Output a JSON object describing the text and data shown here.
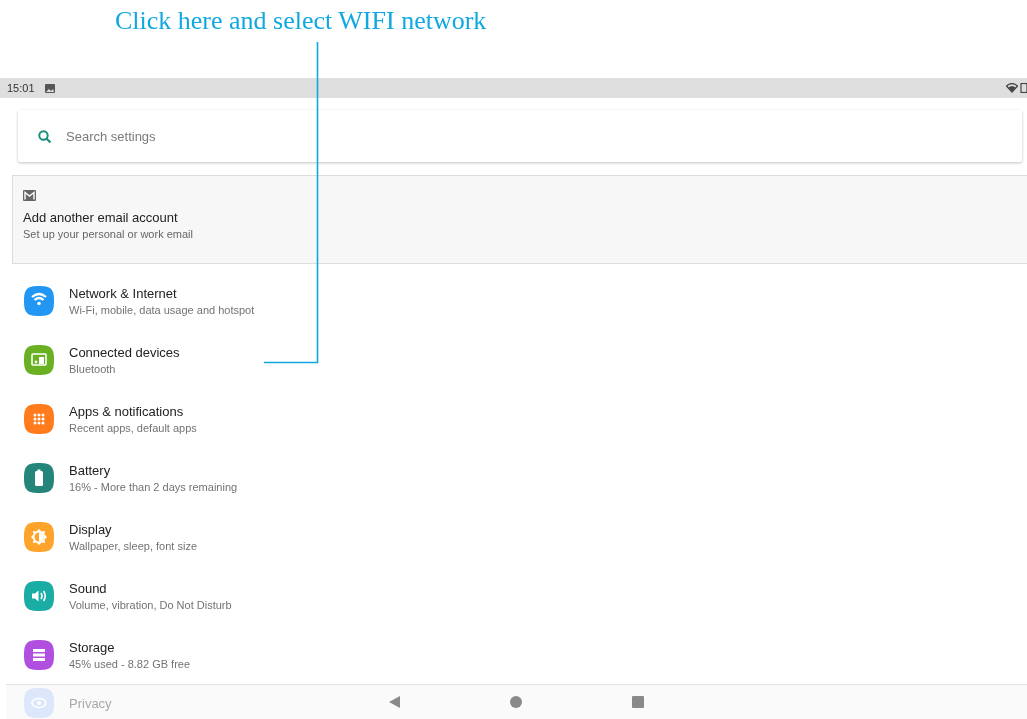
{
  "annotation": {
    "text": "Click here and select WIFI network"
  },
  "status_bar": {
    "time": "15:01"
  },
  "search": {
    "placeholder": "Search settings"
  },
  "account_suggestion": {
    "title": "Add another email account",
    "subtitle": "Set up your personal or work email"
  },
  "settings": [
    {
      "kind": "wifi",
      "color": "#2196f3",
      "title": "Network & Internet",
      "subtitle": "Wi-Fi, mobile, data usage and hotspot"
    },
    {
      "kind": "devices",
      "color": "#6ab023",
      "title": "Connected devices",
      "subtitle": "Bluetooth"
    },
    {
      "kind": "apps",
      "color": "#ff7b1c",
      "title": "Apps & notifications",
      "subtitle": "Recent apps, default apps"
    },
    {
      "kind": "battery",
      "color": "#24857a",
      "title": "Battery",
      "subtitle": "16% - More than 2 days remaining"
    },
    {
      "kind": "display",
      "color": "#ffa42a",
      "title": "Display",
      "subtitle": "Wallpaper, sleep, font size"
    },
    {
      "kind": "sound",
      "color": "#19ada5",
      "title": "Sound",
      "subtitle": "Volume, vibration, Do Not Disturb"
    },
    {
      "kind": "storage",
      "color": "#b04fe0",
      "title": "Storage",
      "subtitle": "45% used - 8.82 GB free"
    },
    {
      "kind": "privacy",
      "color": "#dce7fb",
      "title": "Privacy"
    }
  ]
}
